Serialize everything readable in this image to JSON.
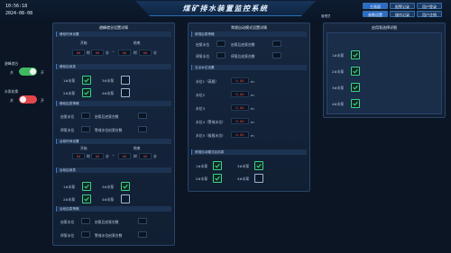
{
  "header": {
    "time": "10:56:18",
    "date": "2024-08-08",
    "title": "煤矿排水装置监控系统",
    "user_label": "管理员",
    "buttons_row1": [
      "主画面",
      "报警记录",
      "用户登录"
    ],
    "buttons_row2": [
      "参数设置",
      "操作记录",
      "用户注销"
    ]
  },
  "left_controls": {
    "toggle1": {
      "label": "避峰就谷",
      "off_label": "关",
      "on_label": "开",
      "state": "on",
      "color": "#3fb861"
    },
    "toggle2": {
      "label": "水泵轮换",
      "off_label": "关",
      "on_label": "开",
      "state": "off",
      "color": "#e2474b"
    }
  },
  "panel_left": {
    "title": "避峰就谷设置详情",
    "time_section": "峰段时间设置",
    "start_label": "开始",
    "end_label": "结束",
    "hour_unit": "时",
    "min_unit": "分",
    "tilde": "~",
    "peak_time": [
      "00",
      "00",
      "00",
      "00"
    ],
    "peak_pumps_title": "峰段启用泵",
    "pumps": [
      "1#水泵",
      "2#水泵",
      "3#水泵",
      "4#水泵"
    ],
    "peak_pumps_checked": [
      true,
      true,
      false,
      false
    ],
    "peak_strategy": "峰段启泵策略",
    "start_level": "启泵水位",
    "start_count": "启泵后启泵台数",
    "stop_level": "停泵水位",
    "alarm_count": "警戒水位启泵台数",
    "valley_time_section": "谷段时间设置",
    "valley_time": [
      "00",
      "00",
      "00",
      "00"
    ],
    "valley_pumps_title": "谷段启用泵",
    "valley_pumps_checked": [
      true,
      true,
      true,
      false
    ],
    "valley_strategy": "谷段启泵策略"
  },
  "panel_mid": {
    "title": "常规自动模式设置详情",
    "strategy": "常规启泵策略",
    "start_level": "启泵水位",
    "start_count": "启泵后启泵台数",
    "stop_level": "停泵水位",
    "stop_count": "停泵后启泵台数",
    "levels_title": "五点水位设置",
    "levels": [
      {
        "label": "水位1（高限）",
        "value": "0.00",
        "unit": "m"
      },
      {
        "label": "水位2",
        "value": "0.00",
        "unit": "m"
      },
      {
        "label": "水位3",
        "value": "0.00",
        "unit": "m"
      },
      {
        "label": "水位4（警戒水位）",
        "value": "0.00",
        "unit": "m"
      },
      {
        "label": "水位5（极限水位）",
        "value": "0.00",
        "unit": "m"
      }
    ],
    "pumps_title": "常规自动模式启用泵",
    "pumps": [
      "1#水泵",
      "3#水泵",
      "2#水泵",
      "4#水泵"
    ],
    "pumps_checked": [
      true,
      true,
      true,
      false
    ]
  },
  "panel_right": {
    "title": "启用泵选择详细",
    "pumps": [
      "1#水泵",
      "2#水泵",
      "3#水泵",
      "4#水泵"
    ],
    "checked": [
      true,
      true,
      true,
      true
    ]
  }
}
